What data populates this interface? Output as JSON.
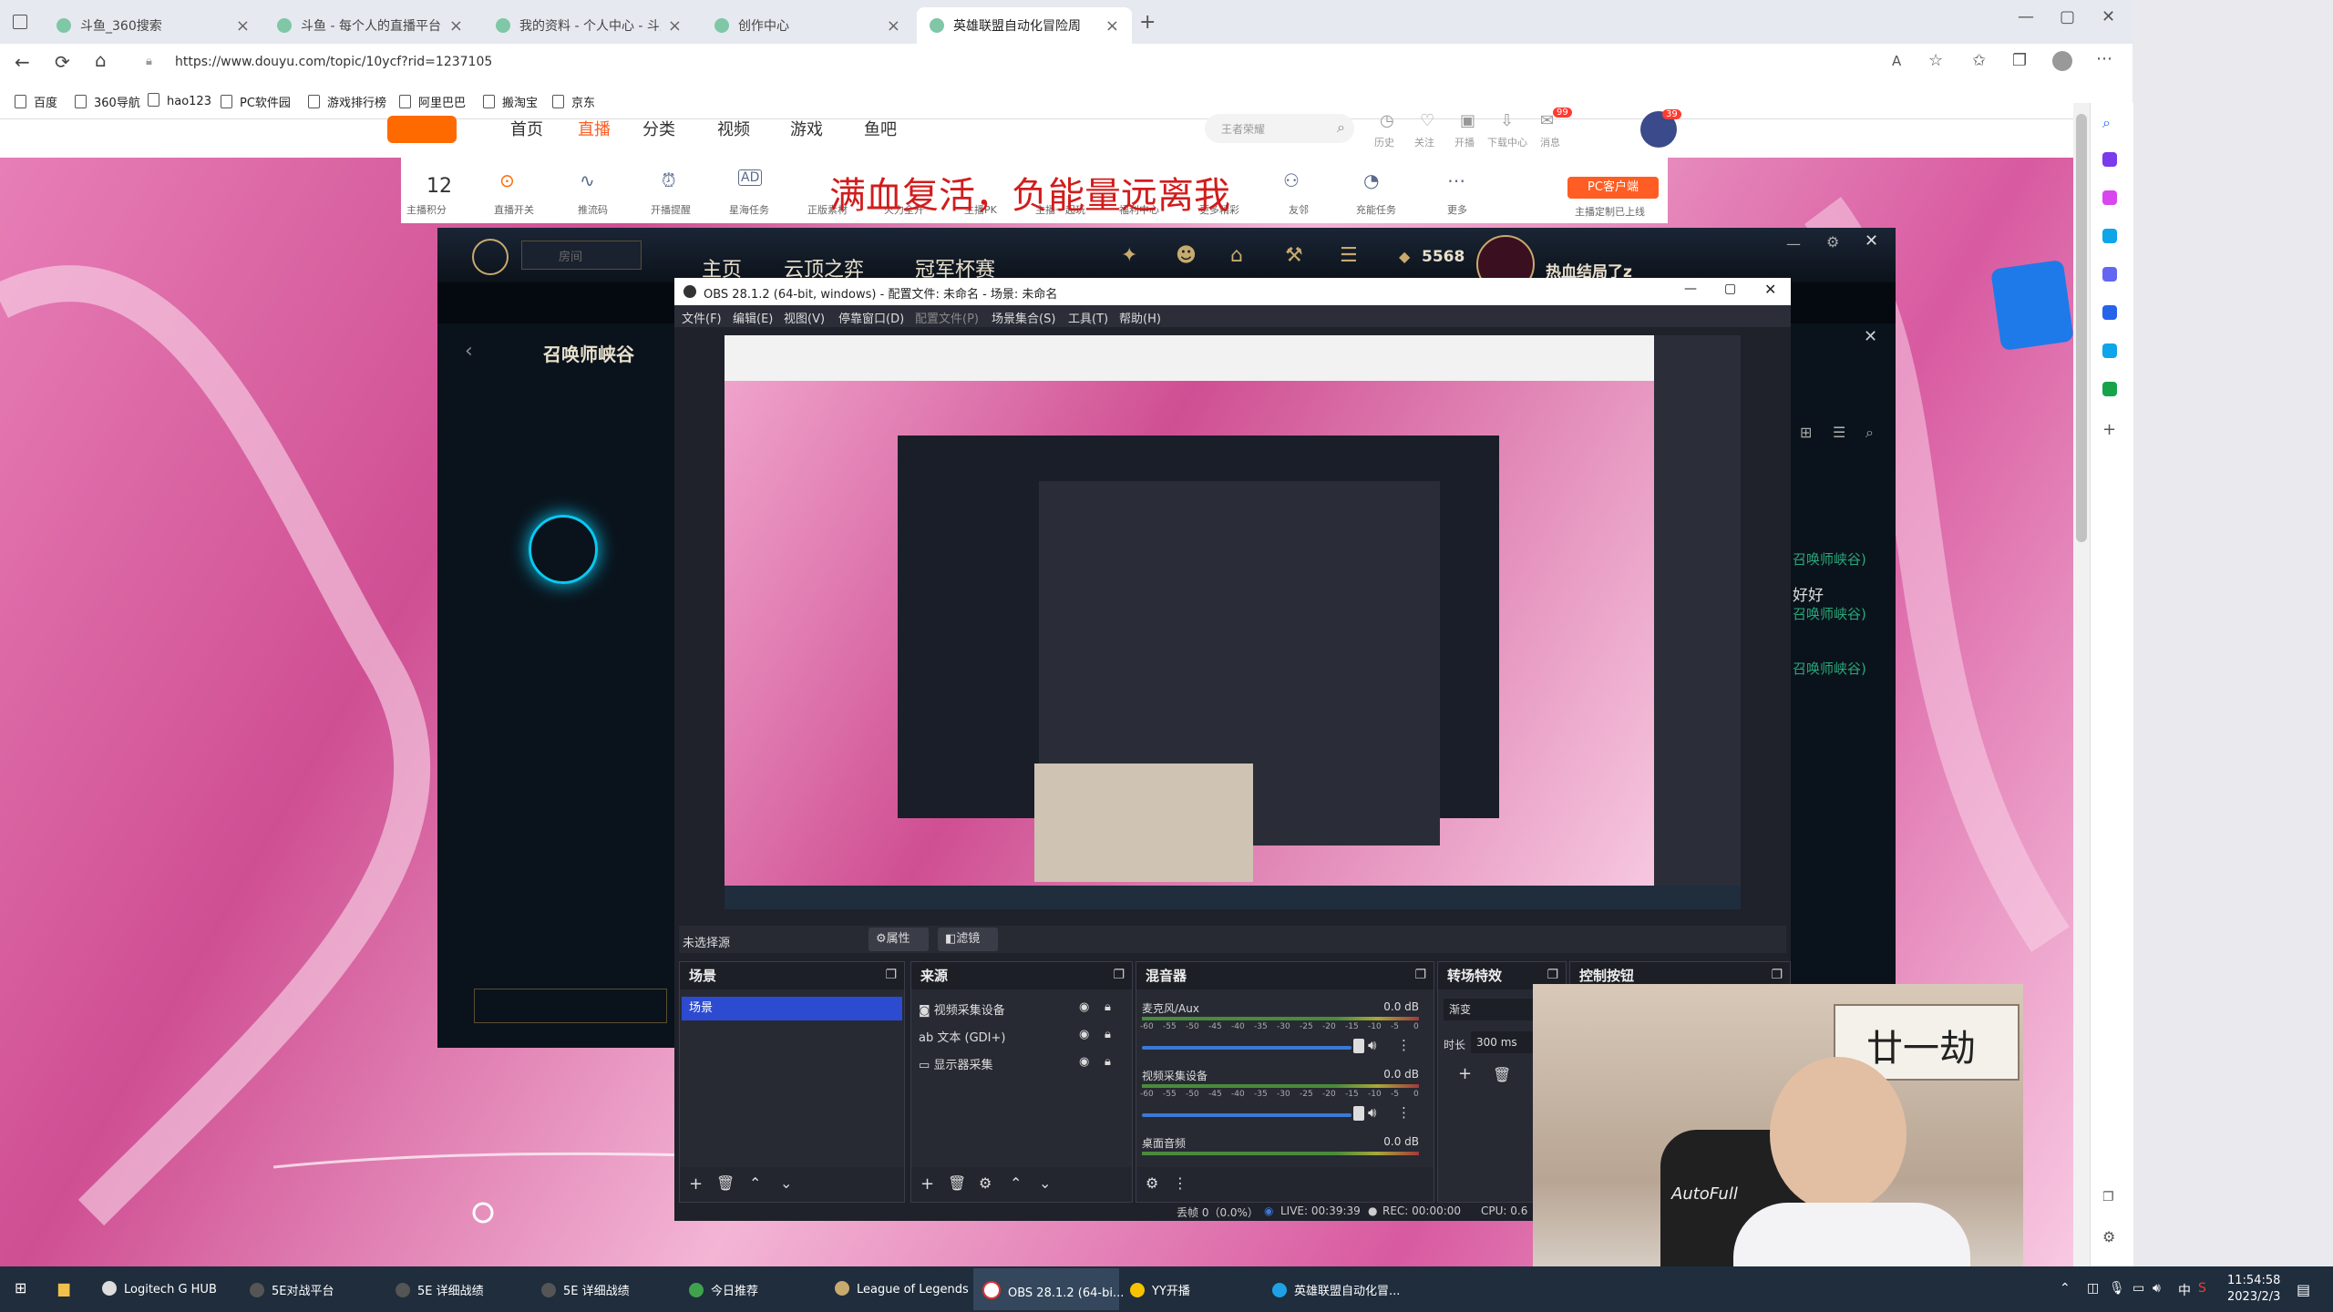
{
  "browser": {
    "tabs": [
      {
        "title": "斗鱼_360搜索",
        "active": false
      },
      {
        "title": "斗鱼 - 每个人的直播平台",
        "active": false
      },
      {
        "title": "我的资料 - 个人中心 - 斗鱼",
        "active": false
      },
      {
        "title": "创作中心",
        "active": false
      },
      {
        "title": "英雄联盟自动化冒险周",
        "active": true
      }
    ],
    "url": "https://www.douyu.com/topic/10ycf?rid=1237105",
    "bookmarks": [
      "百度",
      "360导航",
      "hao123",
      "PC软件园",
      "游戏排行榜",
      "阿里巴巴",
      "搬淘宝",
      "京东"
    ]
  },
  "douyu": {
    "nav": [
      "首页",
      "直播",
      "分类",
      "视频",
      "游戏",
      "鱼吧"
    ],
    "search_placeholder": "王者荣耀",
    "user_icons": [
      "历史",
      "关注",
      "开播",
      "下载中心",
      "消息",
      "创作中心"
    ],
    "message_badge": "99",
    "avatar_badge": "39",
    "tools": [
      {
        "label": "主播积分",
        "value": "12"
      },
      {
        "label": "直播开关"
      },
      {
        "label": "推流码"
      },
      {
        "label": "开播提醒"
      },
      {
        "label": "星海任务"
      },
      {
        "label": "正版素材"
      },
      {
        "label": "火力全开"
      },
      {
        "label": "主播PK"
      },
      {
        "label": "主播一起玩"
      },
      {
        "label": "福利中心"
      },
      {
        "label": "更多精彩"
      },
      {
        "label": "友邻"
      },
      {
        "label": "充能任务"
      },
      {
        "label": "更多"
      }
    ],
    "banner_text": "满血复活，负能量远离我",
    "pc_client_button": "PC客户端",
    "pc_client_sub": "主播定制已上线"
  },
  "lol": {
    "search_placeholder": "房间",
    "nav": [
      "主页",
      "云顶之弈",
      "冠军杯赛"
    ],
    "currency": "5568",
    "summoner": "热血结局了z",
    "map_title": "召唤师峡谷",
    "chat_lines": [
      "召唤师峡谷)",
      "好好",
      "召唤师峡谷)",
      "召唤师峡谷)"
    ]
  },
  "obs": {
    "title": "OBS 28.1.2 (64-bit, windows) - 配置文件: 未命名 - 场景: 未命名",
    "menu": [
      "文件(F)",
      "编辑(E)",
      "视图(V)",
      "停靠窗口(D)",
      "配置文件(P)",
      "场景集合(S)",
      "工具(T)",
      "帮助(H)"
    ],
    "no_source": "未选择源",
    "properties_btn": "属性",
    "filters_btn": "滤镜",
    "scenes": {
      "title": "场景",
      "items": [
        "场景"
      ]
    },
    "sources": {
      "title": "来源",
      "items": [
        "视频采集设备",
        "文本 (GDI+)",
        "显示器采集"
      ]
    },
    "mixer": {
      "title": "混音器",
      "channels": [
        {
          "name": "麦克风/Aux",
          "db": "0.0 dB"
        },
        {
          "name": "视频采集设备",
          "db": "0.0 dB"
        },
        {
          "name": "桌面音频",
          "db": "0.0 dB"
        }
      ],
      "scale": [
        "-60",
        "-55",
        "-50",
        "-45",
        "-40",
        "-35",
        "-30",
        "-25",
        "-20",
        "-15",
        "-10",
        "-5",
        "0"
      ]
    },
    "transitions": {
      "title": "转场特效",
      "value": "渐变",
      "duration_label": "时长",
      "duration": "300 ms"
    },
    "controls": {
      "title": "控制按钮"
    },
    "status": {
      "dropped": "丢帧 0（0.0%）",
      "live": "LIVE: 00:39:39",
      "rec": "REC: 00:00:00",
      "cpu": "CPU: 0.6"
    }
  },
  "webcam": {
    "banner": "廿一劫",
    "chair_brand": "AutoFull"
  },
  "taskbar": {
    "apps": [
      "Logitech G HUB",
      "5E对战平台",
      "5E 详细战绩",
      "5E 详细战绩",
      "今日推荐",
      "League of Legends",
      "OBS 28.1.2 (64-bi...",
      "YY开播",
      "英雄联盟自动化冒..."
    ],
    "time": "11:54:58",
    "date": "2023/2/3",
    "ime": "中"
  },
  "colors": {
    "accent": "#ff5d23",
    "obs_blue": "#2c4bd1",
    "page_pink": "#d85aa0"
  }
}
